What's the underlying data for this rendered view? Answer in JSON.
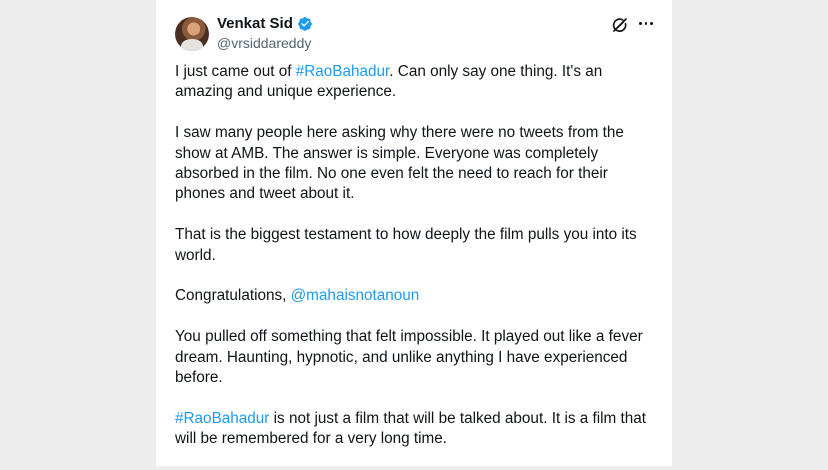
{
  "author": {
    "name": "Venkat Sid",
    "handle": "@vrsiddareddy",
    "verified_color": "#1d9bf0"
  },
  "icons": {
    "grok": "grok-icon",
    "more": "more-options-icon",
    "verified": "verified-badge-icon"
  },
  "tweet": {
    "p1": {
      "pre": "I just came out of ",
      "hashtag": "#RaoBahadur",
      "post": ". Can only say one thing. It's an amazing and unique experience."
    },
    "p2": "I saw many people here asking why there were no tweets from the show at AMB. The answer is simple. Everyone was completely absorbed in the film. No one even felt the need to reach for their phones and tweet about it.",
    "p3": "That is the biggest testament to how deeply the film pulls you into its world.",
    "p4": {
      "pre": "Congratulations, ",
      "mention": "@mahaisnotanoun"
    },
    "p5": "You pulled off something that felt impossible. It played out like a fever dream. Haunting, hypnotic, and unlike anything I have experienced before.",
    "p6": {
      "hashtag": "#RaoBahadur",
      "post": " is not just a film that will be talked about. It is a film that will be remembered for a very long time."
    }
  }
}
